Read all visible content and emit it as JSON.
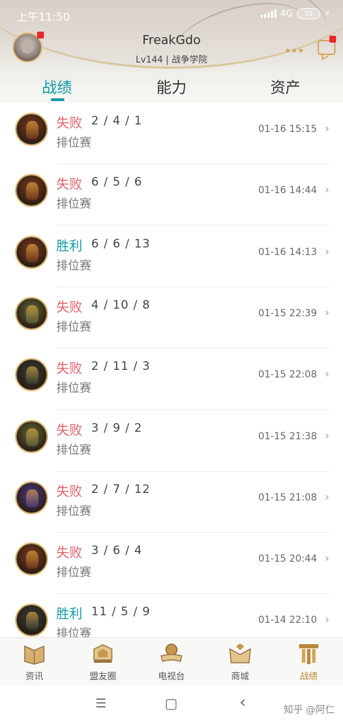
{
  "status_bar": {
    "time": "上午11:50",
    "network": "4G",
    "battery": "33"
  },
  "profile": {
    "username": "FreakGdo",
    "info": "Lv144 | 战争学院"
  },
  "tabs": [
    {
      "label": "战绩",
      "active": true
    },
    {
      "label": "能力",
      "active": false
    },
    {
      "label": "资产",
      "active": false
    }
  ],
  "matches": [
    {
      "result": "失败",
      "outcome": "lose",
      "kda": "2 / 4 / 1",
      "mode": "排位赛",
      "time": "01-16 15:15",
      "champ_color": "#7a3b1e"
    },
    {
      "result": "失败",
      "outcome": "lose",
      "kda": "6 / 5 / 6",
      "mode": "排位赛",
      "time": "01-16 14:44",
      "champ_color": "#7a3b1e"
    },
    {
      "result": "胜利",
      "outcome": "win",
      "kda": "6 / 6 / 13",
      "mode": "排位赛",
      "time": "01-16 14:13",
      "champ_color": "#7a3b1e"
    },
    {
      "result": "失败",
      "outcome": "lose",
      "kda": "4 / 10 / 8",
      "mode": "排位赛",
      "time": "01-15 22:39",
      "champ_color": "#5d6a3a"
    },
    {
      "result": "失败",
      "outcome": "lose",
      "kda": "2 / 11 / 3",
      "mode": "排位赛",
      "time": "01-15 22:08",
      "champ_color": "#2f3d36"
    },
    {
      "result": "失败",
      "outcome": "lose",
      "kda": "3 / 9 / 2",
      "mode": "排位赛",
      "time": "01-15 21:38",
      "champ_color": "#5d6a3a"
    },
    {
      "result": "失败",
      "outcome": "lose",
      "kda": "2 / 7 / 12",
      "mode": "排位赛",
      "time": "01-15 21:08",
      "champ_color": "#4a3a8a"
    },
    {
      "result": "失败",
      "outcome": "lose",
      "kda": "3 / 6 / 4",
      "mode": "排位赛",
      "time": "01-15 20:44",
      "champ_color": "#7a3b1e"
    },
    {
      "result": "胜利",
      "outcome": "win",
      "kda": "11 / 5 / 9",
      "mode": "排位赛",
      "time": "01-14 22:10",
      "champ_color": "#2f3d36"
    }
  ],
  "bottom_nav": [
    {
      "label": "资讯",
      "icon": "news-icon",
      "active": false
    },
    {
      "label": "盟友圈",
      "icon": "friends-icon",
      "active": false
    },
    {
      "label": "电视台",
      "icon": "tv-icon",
      "active": false
    },
    {
      "label": "商城",
      "icon": "shop-icon",
      "active": false
    },
    {
      "label": "战绩",
      "icon": "record-icon",
      "active": true
    }
  ],
  "system_nav": {
    "menu": "☰",
    "home": "▢",
    "back": "‹"
  },
  "watermark": "知乎 @阿仁",
  "colors": {
    "accent": "#0e9aa7",
    "lose": "#e0646c",
    "win": "#159aa6",
    "gold": "#d2a85e"
  }
}
